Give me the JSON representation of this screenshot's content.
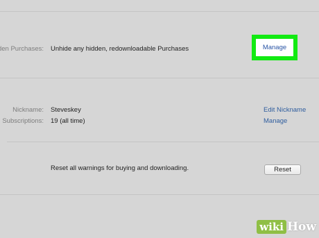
{
  "hidden_purchases": {
    "label": "den Purchases:",
    "description": "Unhide any hidden, redownloadable Purchases",
    "manage_label": "Manage"
  },
  "account": {
    "nickname_label": "Nickname:",
    "nickname_value": "Steveskey",
    "edit_nickname_label": "Edit Nickname",
    "subscriptions_label": "Subscriptions:",
    "subscriptions_value": "19 (all time)",
    "subscriptions_manage_label": "Manage"
  },
  "warnings": {
    "description": "Reset all warnings for buying and downloading.",
    "reset_label": "Reset"
  },
  "watermark": {
    "wiki": "wiki",
    "how": "How"
  },
  "colors": {
    "highlight": "#12ea12",
    "link": "#2f5d9e",
    "watermark_green": "#8fbf45"
  }
}
